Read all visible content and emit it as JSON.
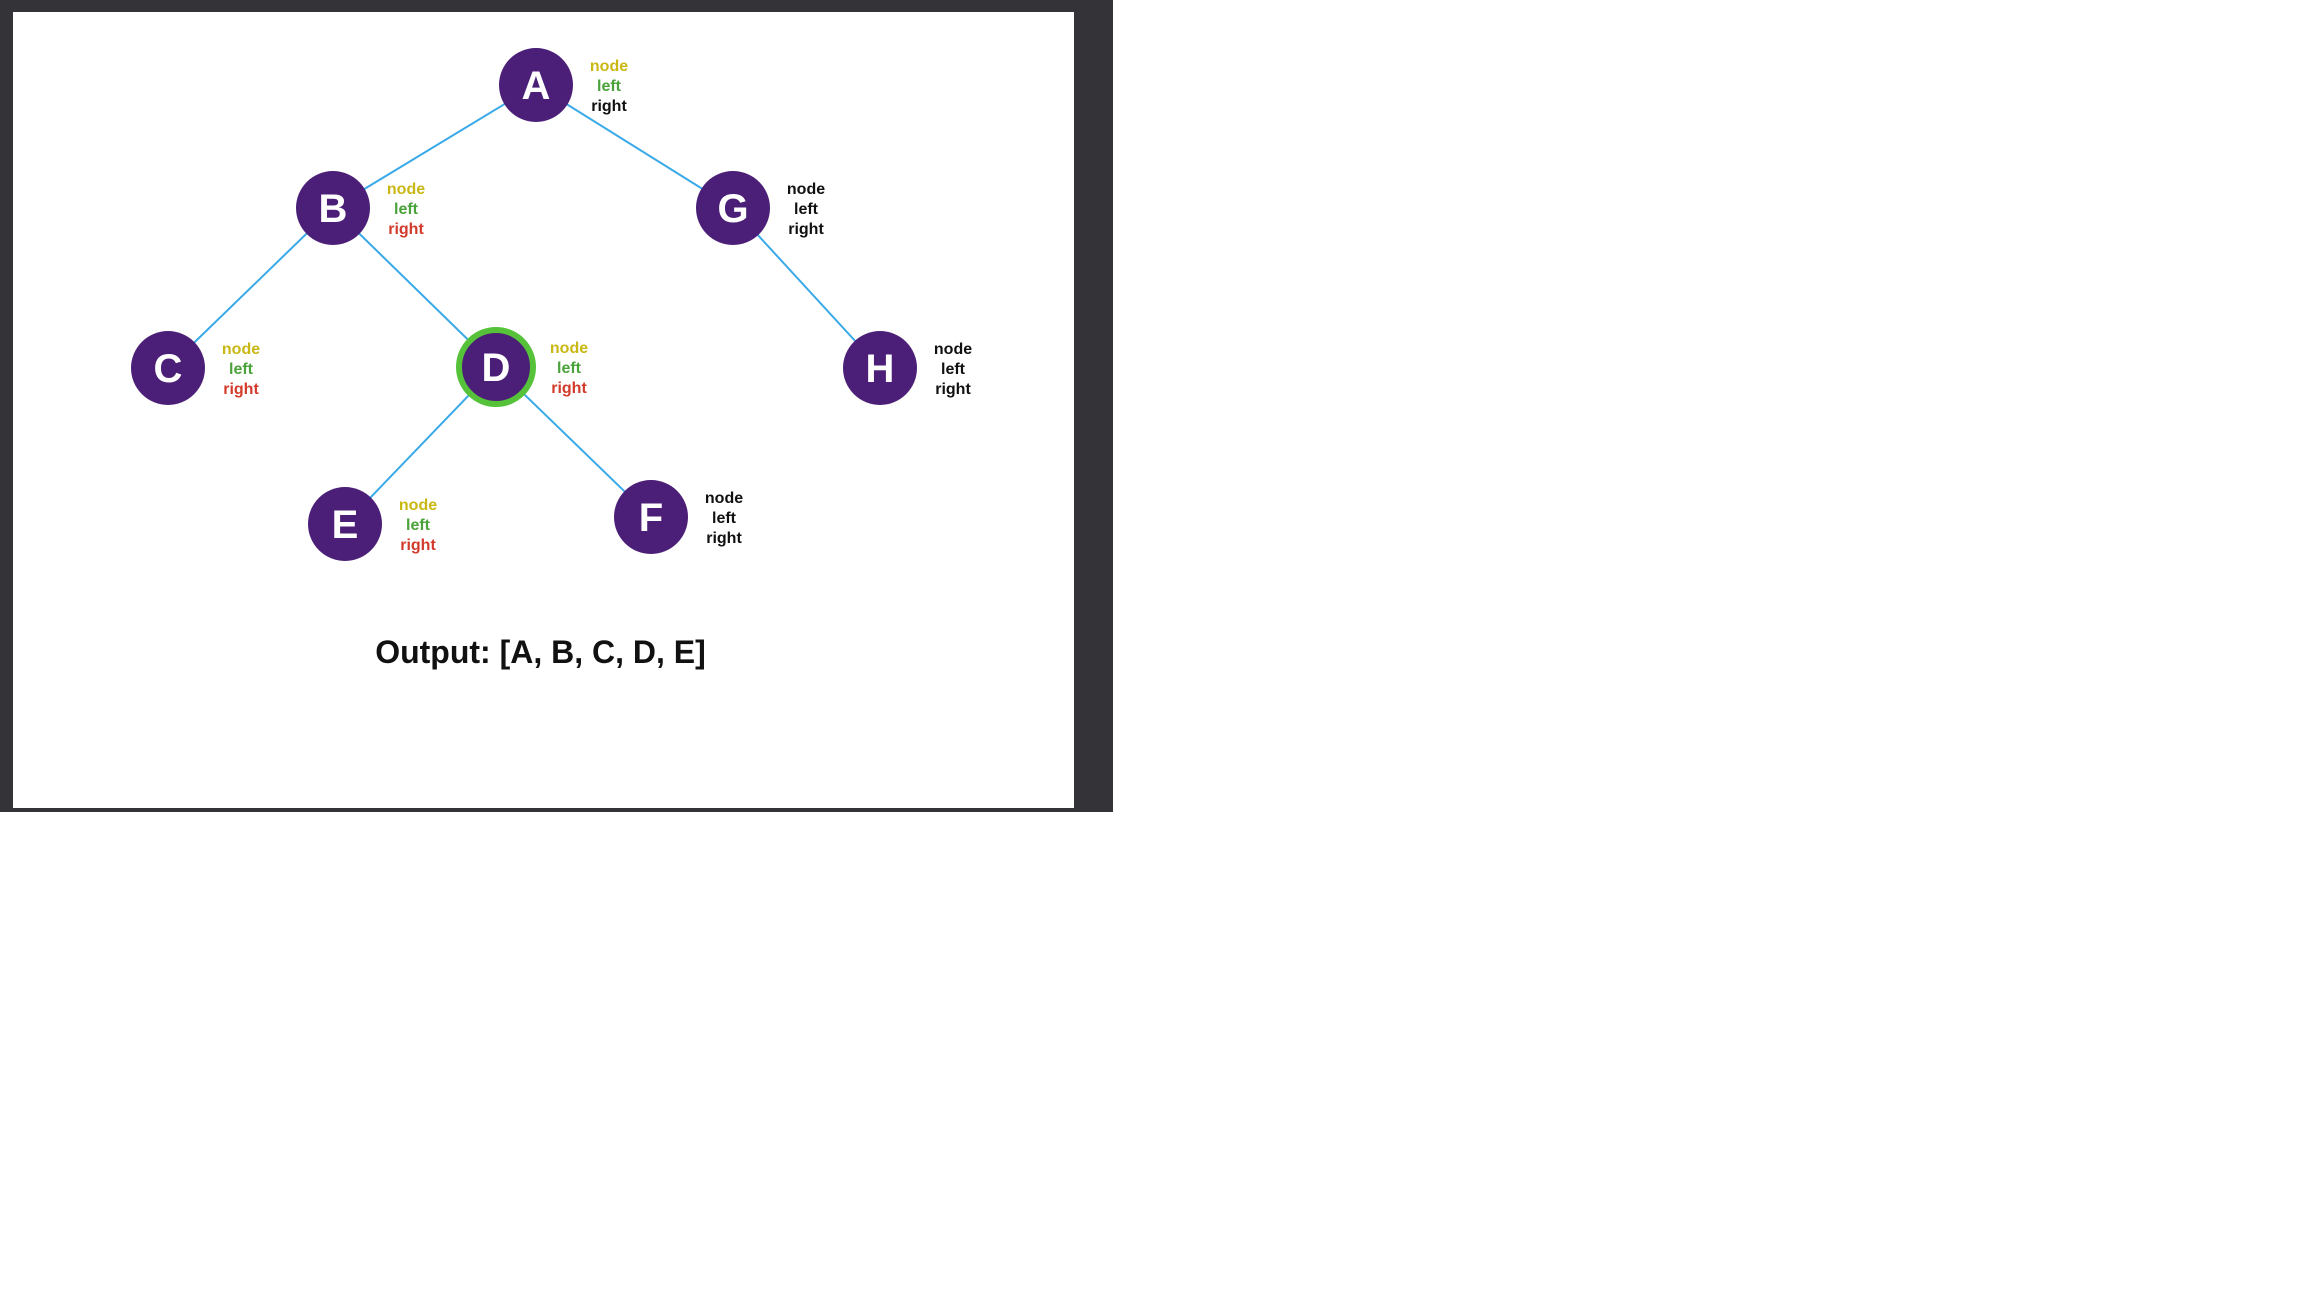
{
  "colors": {
    "frame": "#333338",
    "slide_background": "#ffffff",
    "node_fill": "#4b1f77",
    "node_text": "#ffffff",
    "edge": "#3aa9e8",
    "highlight_ring": "#55c23a",
    "tag_node_visited": "#c9b814",
    "tag_left_visited": "#4aa33a",
    "tag_right_visited": "#d23b2b",
    "tag_default": "#111111"
  },
  "tree": {
    "nodes": [
      {
        "id": "A",
        "label": "A",
        "highlighted": false,
        "tags": {
          "node": "node",
          "left": "left",
          "right": "right"
        },
        "tag_state": [
          "visited",
          "visited",
          "default"
        ]
      },
      {
        "id": "B",
        "label": "B",
        "highlighted": false,
        "tags": {
          "node": "node",
          "left": "left",
          "right": "right"
        },
        "tag_state": [
          "visited",
          "visited",
          "visited"
        ]
      },
      {
        "id": "G",
        "label": "G",
        "highlighted": false,
        "tags": {
          "node": "node",
          "left": "left",
          "right": "right"
        },
        "tag_state": [
          "default",
          "default",
          "default"
        ]
      },
      {
        "id": "C",
        "label": "C",
        "highlighted": false,
        "tags": {
          "node": "node",
          "left": "left",
          "right": "right"
        },
        "tag_state": [
          "visited",
          "visited",
          "visited"
        ]
      },
      {
        "id": "D",
        "label": "D",
        "highlighted": true,
        "tags": {
          "node": "node",
          "left": "left",
          "right": "right"
        },
        "tag_state": [
          "visited",
          "visited",
          "visited"
        ]
      },
      {
        "id": "H",
        "label": "H",
        "highlighted": false,
        "tags": {
          "node": "node",
          "left": "left",
          "right": "right"
        },
        "tag_state": [
          "default",
          "default",
          "default"
        ]
      },
      {
        "id": "E",
        "label": "E",
        "highlighted": false,
        "tags": {
          "node": "node",
          "left": "left",
          "right": "right"
        },
        "tag_state": [
          "visited",
          "visited",
          "visited"
        ]
      },
      {
        "id": "F",
        "label": "F",
        "highlighted": false,
        "tags": {
          "node": "node",
          "left": "left",
          "right": "right"
        },
        "tag_state": [
          "default",
          "default",
          "default"
        ]
      }
    ],
    "edges": [
      [
        "A",
        "B"
      ],
      [
        "A",
        "G"
      ],
      [
        "B",
        "C"
      ],
      [
        "B",
        "D"
      ],
      [
        "G",
        "H"
      ],
      [
        "D",
        "E"
      ],
      [
        "D",
        "F"
      ]
    ]
  },
  "output": {
    "text": "Output: [A, B, C, D, E]"
  }
}
